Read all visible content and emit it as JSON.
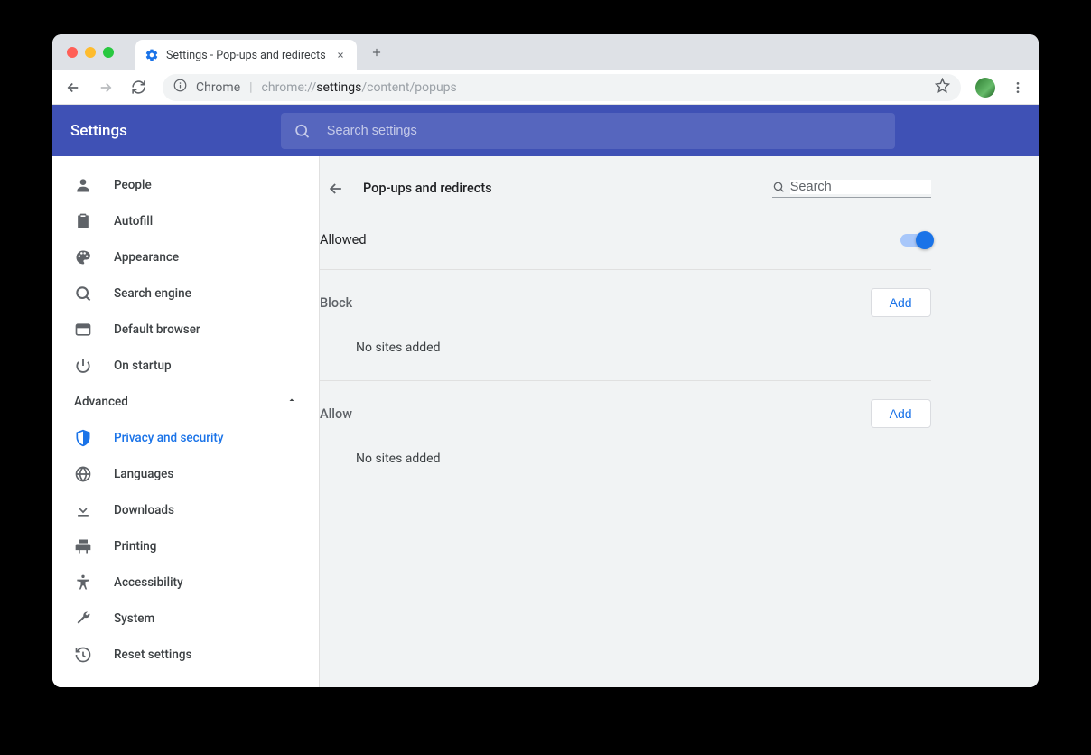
{
  "tab": {
    "title": "Settings - Pop-ups and redirects"
  },
  "omnibox": {
    "pill": "Chrome",
    "scheme": "chrome://",
    "bold": "settings",
    "rest": "/content/popups"
  },
  "header": {
    "title": "Settings",
    "search_placeholder": "Search settings"
  },
  "sidebar": {
    "items": [
      {
        "label": "People",
        "icon": "person"
      },
      {
        "label": "Autofill",
        "icon": "clipboard"
      },
      {
        "label": "Appearance",
        "icon": "palette"
      },
      {
        "label": "Search engine",
        "icon": "search"
      },
      {
        "label": "Default browser",
        "icon": "browser"
      },
      {
        "label": "On startup",
        "icon": "power"
      }
    ],
    "advanced_label": "Advanced",
    "advanced_items": [
      {
        "label": "Privacy and security",
        "icon": "shield",
        "selected": true
      },
      {
        "label": "Languages",
        "icon": "globe"
      },
      {
        "label": "Downloads",
        "icon": "download"
      },
      {
        "label": "Printing",
        "icon": "print"
      },
      {
        "label": "Accessibility",
        "icon": "accessibility"
      },
      {
        "label": "System",
        "icon": "wrench"
      },
      {
        "label": "Reset settings",
        "icon": "history"
      }
    ]
  },
  "main": {
    "title": "Pop-ups and redirects",
    "search_placeholder": "Search",
    "allowed_label": "Allowed",
    "allowed_value": true,
    "block": {
      "heading": "Block",
      "add_label": "Add",
      "empty": "No sites added"
    },
    "allow": {
      "heading": "Allow",
      "add_label": "Add",
      "empty": "No sites added"
    }
  }
}
